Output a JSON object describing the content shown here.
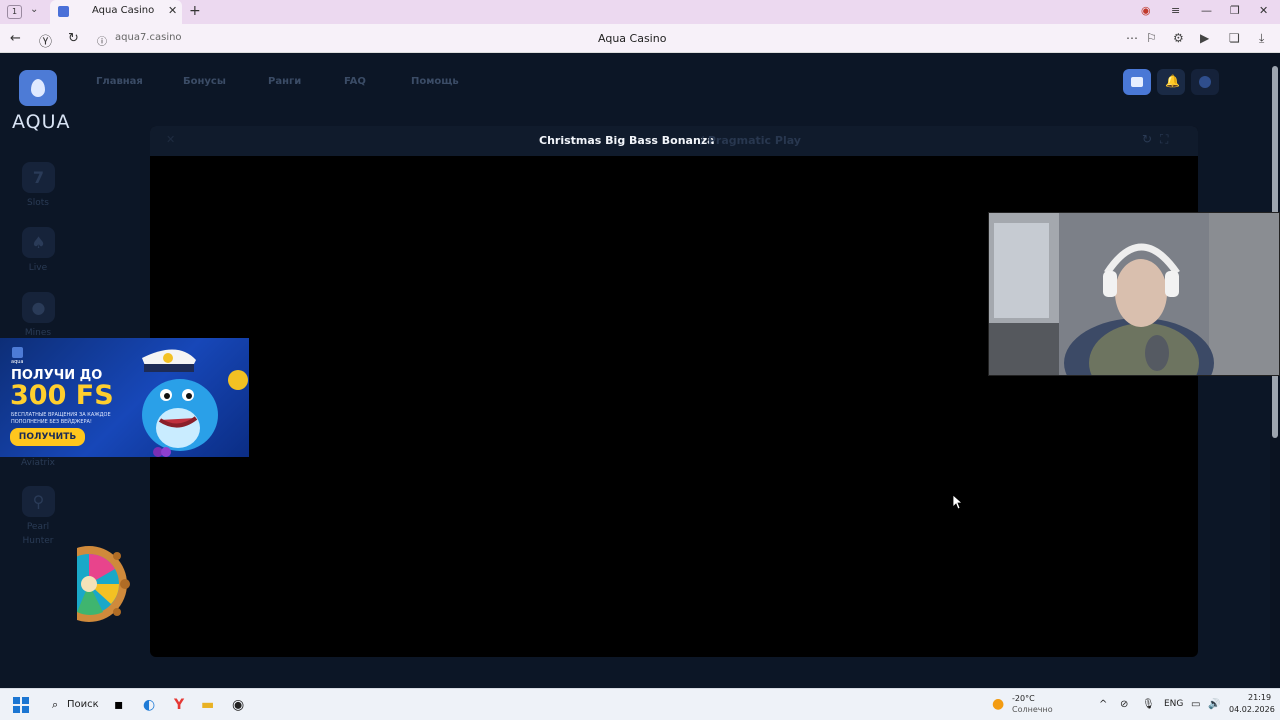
{
  "browser": {
    "tab_number": "1",
    "tab_title": "Aqua Casino",
    "url": "aqua7.casino",
    "page_title": "Aqua Casino"
  },
  "site": {
    "logo_text": "AQUA",
    "nav": [
      "Главная",
      "Бонусы",
      "Ранги",
      "FAQ",
      "Помощь"
    ],
    "sidebar": [
      {
        "icon": "7",
        "label": "Slots"
      },
      {
        "icon": "♠",
        "label": "Live"
      },
      {
        "icon": "●",
        "label": "Mines"
      },
      {
        "icon": "",
        "label": "Aviatrix"
      },
      {
        "icon": "⚲",
        "label": "Pearl"
      },
      {
        "icon": "",
        "label": "Hunter"
      }
    ],
    "game": {
      "title": "Christmas Big Bass Bonanza",
      "provider": "/ Pragmatic Play"
    },
    "promo": {
      "logo_text": "aqua",
      "line1": "ПОЛУЧИ ДО",
      "line2": "300 FS",
      "small": "БЕСПЛАТНЫЕ ВРАЩЕНИЯ ЗА КАЖДОЕ ПОПОЛНЕНИЕ БЕЗ ВЕЙДЖЕРА!",
      "button": "ПОЛУЧИТЬ"
    }
  },
  "taskbar": {
    "search": "Поиск",
    "weather_temp": "-20°C",
    "weather_desc": "Солнечно",
    "lang": "ENG",
    "time": "21:19",
    "date": "04.02.2026"
  },
  "colors": {
    "accent": "#4d7bd6",
    "promo_yellow": "#ffc61d",
    "background": "#0c1626"
  }
}
